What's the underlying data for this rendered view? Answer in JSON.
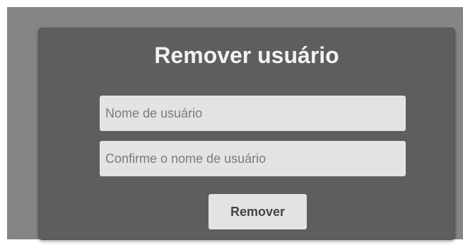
{
  "form": {
    "title": "Remover usuário",
    "username_placeholder": "Nome de usuário",
    "confirm_placeholder": "Confirme o nome de usuário",
    "username_value": "",
    "confirm_value": "",
    "submit_label": "Remover"
  },
  "colors": {
    "backdrop": "#858585",
    "card": "#5e5e5e",
    "field": "#e3e3e3",
    "title_text": "#f2f2f2"
  }
}
